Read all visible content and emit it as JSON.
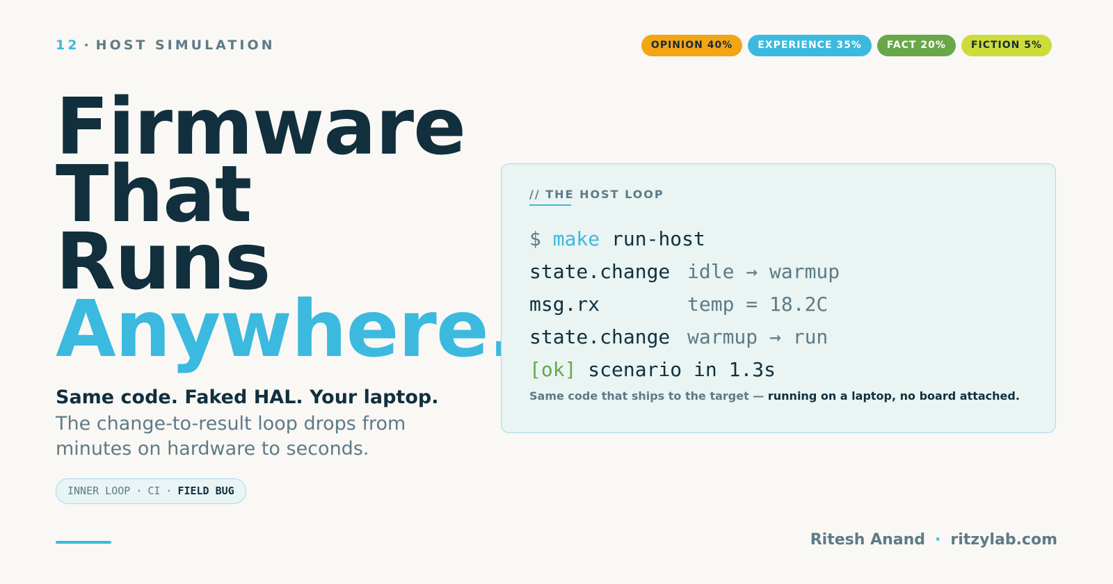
{
  "header": {
    "number": "12",
    "separator": "·",
    "section": "HOST SIMULATION"
  },
  "pills": [
    {
      "label": "OPINION 40%",
      "color": "#f2a515"
    },
    {
      "label": "EXPERIENCE 35%",
      "color": "#3cb9df"
    },
    {
      "label": "FACT 20%",
      "color": "#6aa748"
    },
    {
      "label": "FICTION 5%",
      "color": "#cddc39"
    }
  ],
  "headline": {
    "line1": "Firmware",
    "line2": "That",
    "line3": "Runs",
    "accent": "Anywhere."
  },
  "subhead": {
    "bold": "Same code. Faked HAL. Your laptop.",
    "text": "The change-to-result loop drops from minutes on hardware to seconds."
  },
  "tags": {
    "items": [
      "INNER LOOP",
      "CI"
    ],
    "separator": "·",
    "highlight": "FIELD BUG"
  },
  "panel": {
    "title": "// THE HOST LOOP",
    "command": {
      "prompt": "$",
      "cmd": "make",
      "arg": "run-host"
    },
    "log": [
      {
        "key": "state.change",
        "value": "idle → warmup"
      },
      {
        "key": "msg.rx",
        "value": "temp = 18.2C"
      },
      {
        "key": "state.change",
        "value": "warmup → run"
      }
    ],
    "result": {
      "status": "[ok]",
      "text": "scenario in 1.3s"
    },
    "note": {
      "lead": "Same code that ships to the target —",
      "strong": "running on a laptop, no board attached."
    }
  },
  "footer": {
    "author": "Ritesh Anand",
    "separator": "·",
    "site": "ritzylab.com"
  },
  "colors": {
    "accent": "#3cb9df",
    "ink": "#112f3d",
    "muted": "#5e7a87",
    "ok": "#6aa748"
  }
}
